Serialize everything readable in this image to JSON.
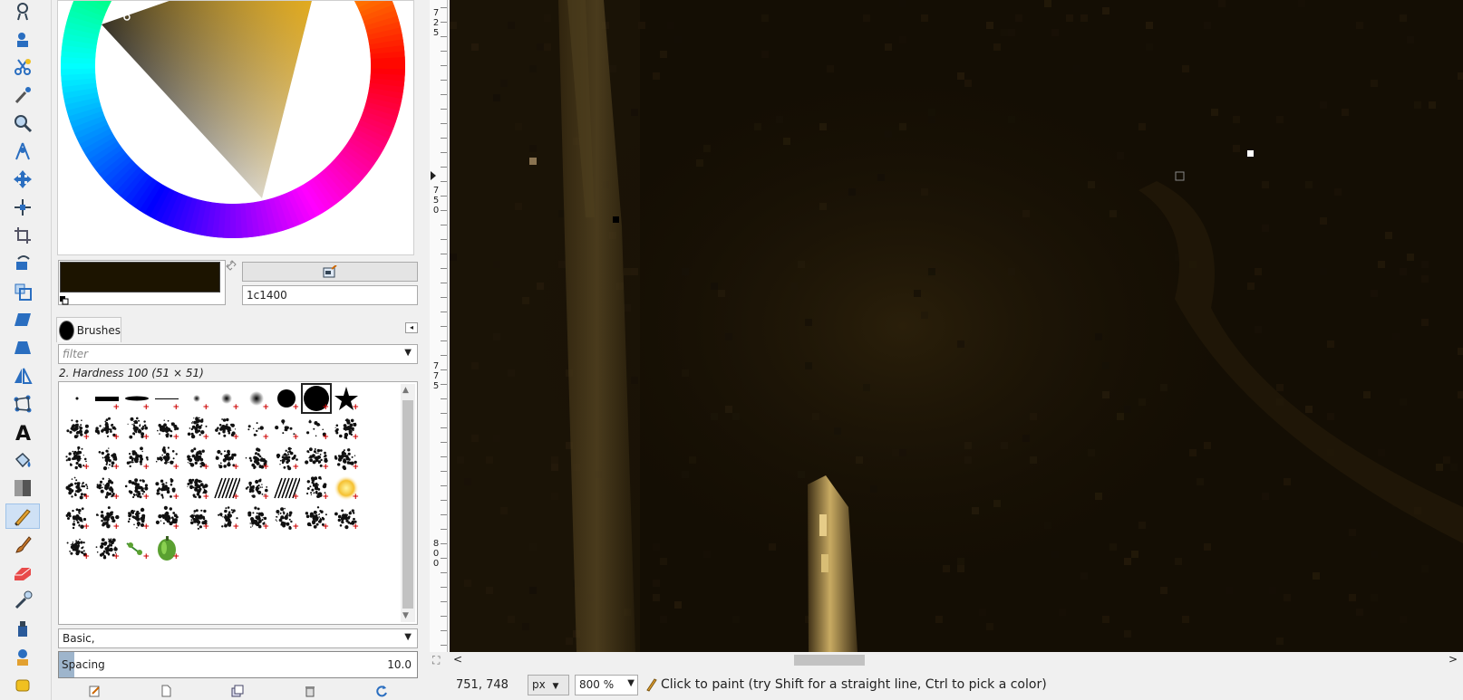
{
  "colors": {
    "foreground": "#1c1400",
    "canvas_bg": "#130d03",
    "accent": "#cfe1f5"
  },
  "color_dialog": {
    "hex_value": "1c1400"
  },
  "toolbox": {
    "tools": [
      {
        "name": "fuzzy-select-icon"
      },
      {
        "name": "foreground-select-icon"
      },
      {
        "name": "scissors-select-icon"
      },
      {
        "name": "color-picker-icon"
      },
      {
        "name": "zoom-icon"
      },
      {
        "name": "measure-icon"
      },
      {
        "name": "move-icon"
      },
      {
        "name": "alignment-icon"
      },
      {
        "name": "crop-icon"
      },
      {
        "name": "rotate-icon"
      },
      {
        "name": "scale-icon"
      },
      {
        "name": "shear-icon"
      },
      {
        "name": "perspective-icon"
      },
      {
        "name": "flip-icon"
      },
      {
        "name": "cage-transform-icon"
      },
      {
        "name": "text-icon"
      },
      {
        "name": "bucket-fill-icon"
      },
      {
        "name": "gradient-icon"
      },
      {
        "name": "pencil-icon"
      },
      {
        "name": "paintbrush-icon"
      },
      {
        "name": "eraser-icon"
      },
      {
        "name": "airbrush-icon"
      },
      {
        "name": "ink-icon"
      },
      {
        "name": "clone-icon"
      },
      {
        "name": "heal-icon"
      }
    ],
    "active_tool": "pencil-icon"
  },
  "brushes": {
    "tab_label": "Brushes",
    "filter_placeholder": "filter",
    "selected_brush": "2. Hardness 100 (51 × 51)",
    "tag": "Basic,",
    "spacing_label": "Spacing",
    "spacing_value": "10.0"
  },
  "ruler": {
    "labels": [
      "725",
      "750",
      "775",
      "800"
    ]
  },
  "status": {
    "coords": "751, 748",
    "unit": "px",
    "zoom": "800 %",
    "message": "Click to paint (try Shift for a straight line, Ctrl to pick a color)"
  }
}
